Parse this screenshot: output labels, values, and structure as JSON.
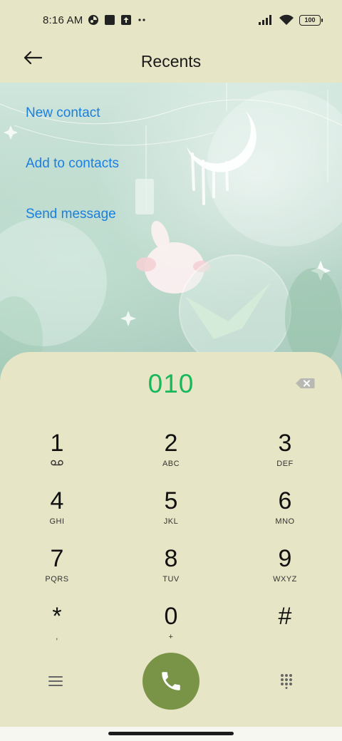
{
  "status_bar": {
    "time": "8:16 AM",
    "icons_left": [
      "app-notification-icon",
      "square-notification-icon",
      "upload-icon",
      "more-dots-icon"
    ],
    "icons_right": [
      "signal-icon",
      "wifi-icon",
      "battery-icon"
    ],
    "battery_level": "100"
  },
  "header": {
    "title": "Recents",
    "back_icon": "arrow-left-icon"
  },
  "actions": {
    "new_contact": "New contact",
    "add_to_contacts": "Add to contacts",
    "send_message": "Send message"
  },
  "dialer": {
    "number": "010",
    "delete_icon": "backspace-icon",
    "keys": [
      {
        "digit": "1",
        "sub": "",
        "sub_icon": "voicemail-icon"
      },
      {
        "digit": "2",
        "sub": "ABC"
      },
      {
        "digit": "3",
        "sub": "DEF"
      },
      {
        "digit": "4",
        "sub": "GHI"
      },
      {
        "digit": "5",
        "sub": "JKL"
      },
      {
        "digit": "6",
        "sub": "MNO"
      },
      {
        "digit": "7",
        "sub": "PQRS"
      },
      {
        "digit": "8",
        "sub": "TUV"
      },
      {
        "digit": "9",
        "sub": "WXYZ"
      },
      {
        "digit": "*",
        "sub": ","
      },
      {
        "digit": "0",
        "sub": "+"
      },
      {
        "digit": "#",
        "sub": ""
      }
    ],
    "bottom": {
      "menu_icon": "menu-icon",
      "call_icon": "phone-icon",
      "keypad_icon": "dialpad-icon"
    }
  },
  "colors": {
    "background": "#e6e5c5",
    "accent_link": "#1a7fe0",
    "number_green": "#16b85a",
    "call_button": "#7a9447"
  }
}
